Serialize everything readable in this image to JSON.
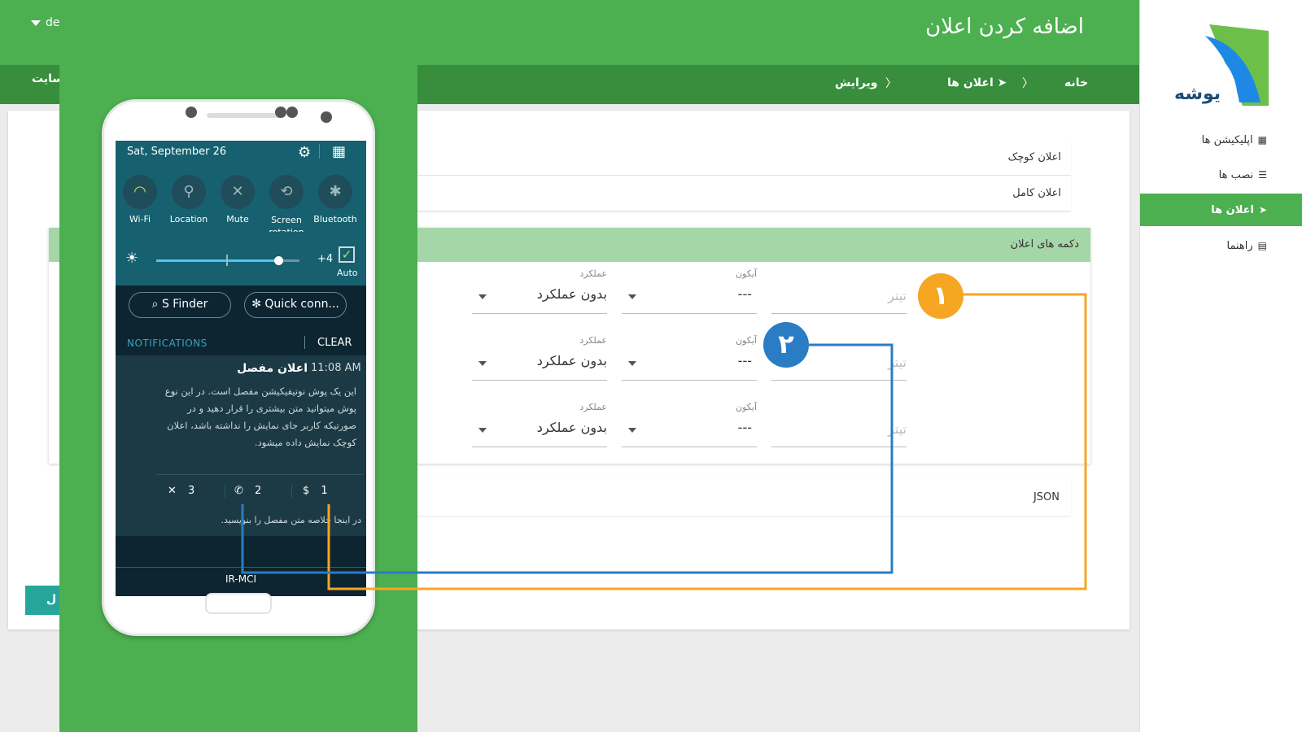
{
  "header": {
    "title": "اضافه کردن اعلان",
    "user_short": "de"
  },
  "breadcrumb": {
    "home": "خانه",
    "sep": "〉",
    "notifications": "اعلان ها",
    "edit": "ویرایش",
    "site_link": "سایت"
  },
  "sidebar": {
    "logo_text": "یوشه",
    "items": [
      {
        "label": "اپلیکیشن ها",
        "icon": "grid-icon",
        "active": false
      },
      {
        "label": "نصب ها",
        "icon": "list-icon",
        "active": false
      },
      {
        "label": "اعلان ها",
        "icon": "send-icon",
        "active": true
      },
      {
        "label": "راهنما",
        "icon": "book-icon",
        "active": false
      }
    ]
  },
  "form": {
    "small_notification": "اعلان کوچک",
    "full_notification": "اعلان کامل",
    "buttons_section_title": "دکمه های اعلان",
    "action_label": "عملکرد",
    "icon_label": "آیکون",
    "title_placeholder": "تیتر",
    "rows": [
      {
        "action": "بدون عملکرد",
        "icon": "---"
      },
      {
        "action": "بدون عملکرد",
        "icon": "---"
      },
      {
        "action": "بدون عملکرد",
        "icon": "---"
      }
    ],
    "json_label": "JSON",
    "submit_partial": "ل"
  },
  "phone": {
    "date": "Sat, September 26",
    "tiles": [
      {
        "label": "Wi-Fi",
        "glyph": "◠",
        "on": true
      },
      {
        "label": "Location",
        "glyph": "⚲",
        "on": false
      },
      {
        "label": "Mute",
        "glyph": "✕",
        "on": false
      },
      {
        "label": "Screen rotation",
        "glyph": "⟲",
        "on": false
      },
      {
        "label": "Bluetooth",
        "glyph": "✱",
        "on": false
      }
    ],
    "brightness": {
      "value_label": "+4",
      "level": 0.85,
      "auto_label": "Auto"
    },
    "s_finder": "S Finder",
    "quick_connect": "Quick conn...",
    "notifications_header": "NOTIFICATIONS",
    "clear_label": "CLEAR",
    "notification": {
      "time": "11:08 AM",
      "title": "اعلان مفصل",
      "body": "این یک پوش نوتیفیکیشن مفصل است. در این نوع پوش میتوانید متن بیشتری را قرار دهید و در صورتیکه کاربر جای نمایش را نداشته باشد، اعلان کوچک نمایش داده میشود.",
      "actions": [
        {
          "glyph": "✕",
          "count": "3"
        },
        {
          "glyph": "✆",
          "count": "2"
        },
        {
          "glyph": "$",
          "count": "1"
        }
      ],
      "summary": "در اینجا خلاصه متن مفصل را بنویسید."
    },
    "carrier": "IR-MCI"
  },
  "annotations": {
    "badge_1": "١",
    "badge_2": "٢",
    "color_orange": "#f5a623",
    "color_blue": "#2a7cc4"
  }
}
